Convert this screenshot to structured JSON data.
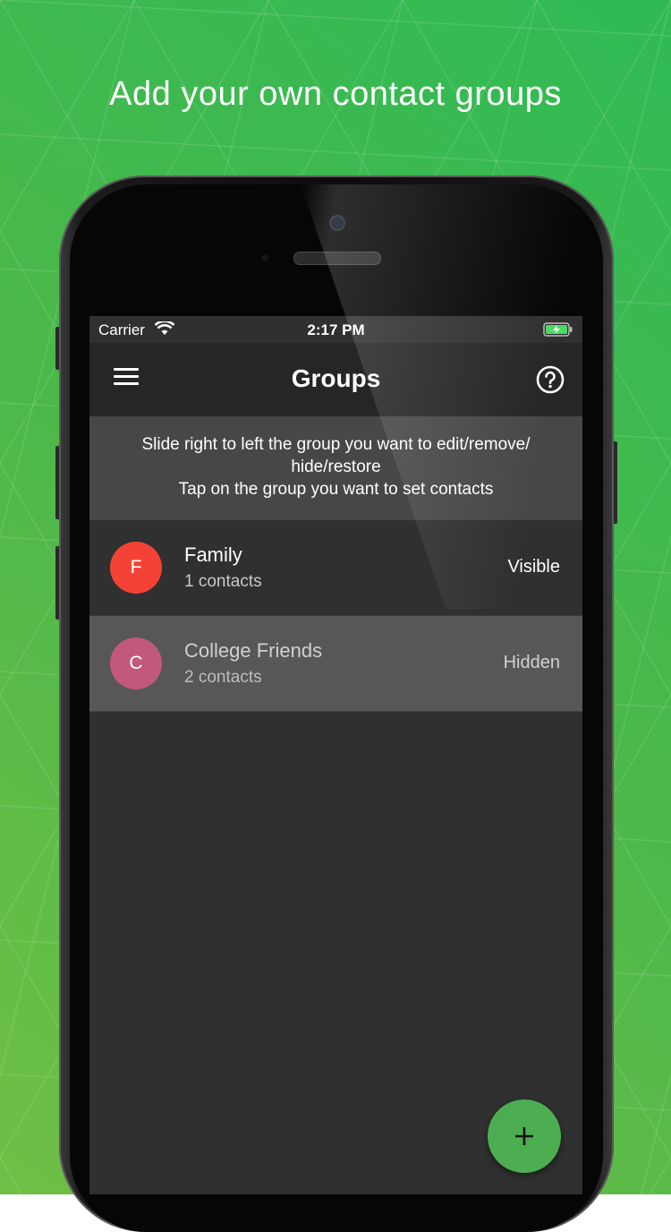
{
  "headline": "Add your own contact groups",
  "status_bar": {
    "carrier": "Carrier",
    "time": "2:17 PM",
    "wifi_icon": "wifi-icon",
    "battery_icon": "battery-charging-icon"
  },
  "app_bar": {
    "title": "Groups",
    "menu_icon": "hamburger-menu-icon",
    "help_icon": "help-circle-icon"
  },
  "hint": {
    "line1": "Slide right to left the group you want to edit/remove/",
    "line2": "hide/restore",
    "line3": "Tap on the group you want to set contacts"
  },
  "groups": [
    {
      "initial": "F",
      "name": "Family",
      "count": "1 contacts",
      "status": "Visible",
      "color": "#f44336"
    },
    {
      "initial": "C",
      "name": "College Friends",
      "count": "2 contacts",
      "status": "Hidden",
      "color": "#c2597c"
    }
  ],
  "fab": {
    "icon": "plus-icon",
    "color": "#4cae50"
  },
  "colors": {
    "background_start": "#6fbf45",
    "background_end": "#2fba55",
    "screen": "#303030",
    "app_bar": "#262626",
    "hint_panel": "#474747"
  }
}
